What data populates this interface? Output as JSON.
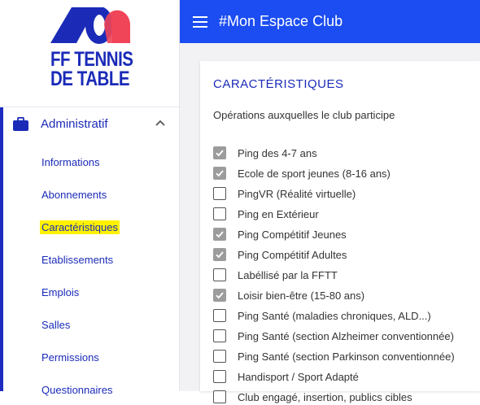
{
  "logo": {
    "line1": "FF TENNIS",
    "line2": "DE TABLE",
    "colors": {
      "blue": "#1b2bb8",
      "red": "#f04458"
    }
  },
  "sidebar": {
    "section": {
      "label": "Administratif",
      "icon": "briefcase-icon",
      "expand_icon": "chevron-up-icon"
    },
    "items": [
      {
        "label": "Informations"
      },
      {
        "label": "Abonnements"
      },
      {
        "label": "Caractéristiques",
        "highlighted": true
      },
      {
        "label": "Etablissements"
      },
      {
        "label": "Emplois"
      },
      {
        "label": "Salles"
      },
      {
        "label": "Permissions"
      },
      {
        "label": "Questionnaires"
      }
    ]
  },
  "header": {
    "title": "#Mon Espace Club",
    "menu_icon": "hamburger-icon",
    "color": "#1c4df2"
  },
  "card": {
    "title": "CARACTÉRISTIQUES",
    "subtitle": "Opérations auxquelles le club participe",
    "options": [
      {
        "label": "Ping des 4-7 ans",
        "checked": true
      },
      {
        "label": "Ecole de sport jeunes (8-16 ans)",
        "checked": true
      },
      {
        "label": "PingVR (Réalité virtuelle)",
        "checked": false
      },
      {
        "label": "Ping en Extérieur",
        "checked": false
      },
      {
        "label": "Ping Compétitif Jeunes",
        "checked": true
      },
      {
        "label": "Ping Compétitif Adultes",
        "checked": true
      },
      {
        "label": "Labéllisé par la FFTT",
        "checked": false
      },
      {
        "label": "Loisir bien-être (15-80 ans)",
        "checked": true
      },
      {
        "label": "Ping Santé (maladies chroniques, ALD...)",
        "checked": false
      },
      {
        "label": "Ping Santé (section Alzheimer conventionnée)",
        "checked": false
      },
      {
        "label": "Ping Santé (section Parkinson conventionnée)",
        "checked": false
      },
      {
        "label": "Handisport / Sport Adapté",
        "checked": false
      },
      {
        "label": "Club engagé, insertion, publics cibles",
        "checked": false
      }
    ]
  }
}
